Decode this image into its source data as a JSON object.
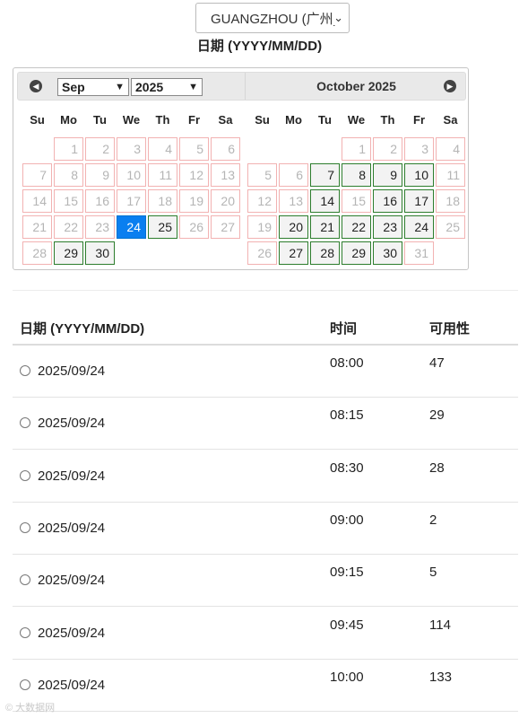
{
  "location": {
    "selected": "GUANGZHOU (广州)"
  },
  "date_label": "日期 (YYYY/MM/DD)",
  "calendar": {
    "month_select": "Sep",
    "year_select": "2025",
    "right_title": "October 2025",
    "weekdays": [
      "Su",
      "Mo",
      "Tu",
      "We",
      "Th",
      "Fr",
      "Sa"
    ],
    "left_month": {
      "name": "September 2025",
      "days": [
        {
          "d": "1",
          "s": "disabled"
        },
        {
          "d": "2",
          "s": "disabled"
        },
        {
          "d": "3",
          "s": "disabled"
        },
        {
          "d": "4",
          "s": "disabled"
        },
        {
          "d": "5",
          "s": "disabled"
        },
        {
          "d": "6",
          "s": "disabled"
        },
        {
          "d": "7",
          "s": "disabled"
        },
        {
          "d": "8",
          "s": "disabled"
        },
        {
          "d": "9",
          "s": "disabled"
        },
        {
          "d": "10",
          "s": "disabled"
        },
        {
          "d": "11",
          "s": "disabled"
        },
        {
          "d": "12",
          "s": "disabled"
        },
        {
          "d": "13",
          "s": "disabled"
        },
        {
          "d": "14",
          "s": "disabled"
        },
        {
          "d": "15",
          "s": "disabled"
        },
        {
          "d": "16",
          "s": "disabled"
        },
        {
          "d": "17",
          "s": "disabled"
        },
        {
          "d": "18",
          "s": "disabled"
        },
        {
          "d": "19",
          "s": "disabled"
        },
        {
          "d": "20",
          "s": "disabled"
        },
        {
          "d": "21",
          "s": "disabled"
        },
        {
          "d": "22",
          "s": "disabled"
        },
        {
          "d": "23",
          "s": "disabled"
        },
        {
          "d": "24",
          "s": "selected"
        },
        {
          "d": "25",
          "s": "available"
        },
        {
          "d": "26",
          "s": "disabled"
        },
        {
          "d": "27",
          "s": "disabled"
        },
        {
          "d": "28",
          "s": "disabled"
        },
        {
          "d": "29",
          "s": "available"
        },
        {
          "d": "30",
          "s": "available"
        }
      ]
    },
    "right_month": {
      "name": "October 2025",
      "days": [
        {
          "d": "1",
          "s": "disabled"
        },
        {
          "d": "2",
          "s": "disabled"
        },
        {
          "d": "3",
          "s": "disabled"
        },
        {
          "d": "4",
          "s": "disabled"
        },
        {
          "d": "5",
          "s": "disabled"
        },
        {
          "d": "6",
          "s": "disabled"
        },
        {
          "d": "7",
          "s": "available"
        },
        {
          "d": "8",
          "s": "available"
        },
        {
          "d": "9",
          "s": "available"
        },
        {
          "d": "10",
          "s": "available"
        },
        {
          "d": "11",
          "s": "disabled"
        },
        {
          "d": "12",
          "s": "disabled"
        },
        {
          "d": "13",
          "s": "disabled"
        },
        {
          "d": "14",
          "s": "available"
        },
        {
          "d": "15",
          "s": "disabled"
        },
        {
          "d": "16",
          "s": "available"
        },
        {
          "d": "17",
          "s": "available"
        },
        {
          "d": "18",
          "s": "disabled"
        },
        {
          "d": "19",
          "s": "disabled"
        },
        {
          "d": "20",
          "s": "available"
        },
        {
          "d": "21",
          "s": "available"
        },
        {
          "d": "22",
          "s": "available"
        },
        {
          "d": "23",
          "s": "available"
        },
        {
          "d": "24",
          "s": "available"
        },
        {
          "d": "25",
          "s": "disabled"
        },
        {
          "d": "26",
          "s": "disabled"
        },
        {
          "d": "27",
          "s": "available"
        },
        {
          "d": "28",
          "s": "available"
        },
        {
          "d": "29",
          "s": "available"
        },
        {
          "d": "30",
          "s": "available"
        },
        {
          "d": "31",
          "s": "disabled"
        }
      ]
    }
  },
  "table": {
    "headers": {
      "date": "日期 (YYYY/MM/DD)",
      "time": "时间",
      "availability": "可用性"
    },
    "rows": [
      {
        "date": "2025/09/24",
        "time": "08:00",
        "availability": "47"
      },
      {
        "date": "2025/09/24",
        "time": "08:15",
        "availability": "29"
      },
      {
        "date": "2025/09/24",
        "time": "08:30",
        "availability": "28"
      },
      {
        "date": "2025/09/24",
        "time": "09:00",
        "availability": "2"
      },
      {
        "date": "2025/09/24",
        "time": "09:15",
        "availability": "5"
      },
      {
        "date": "2025/09/24",
        "time": "09:45",
        "availability": "114"
      },
      {
        "date": "2025/09/24",
        "time": "10:00",
        "availability": "133"
      }
    ]
  },
  "watermark": "© 大数据网",
  "colors": {
    "selected_day": "#0a7ff0",
    "available_border": "#2d7d2d",
    "disabled_border": "#f2b2b2"
  }
}
